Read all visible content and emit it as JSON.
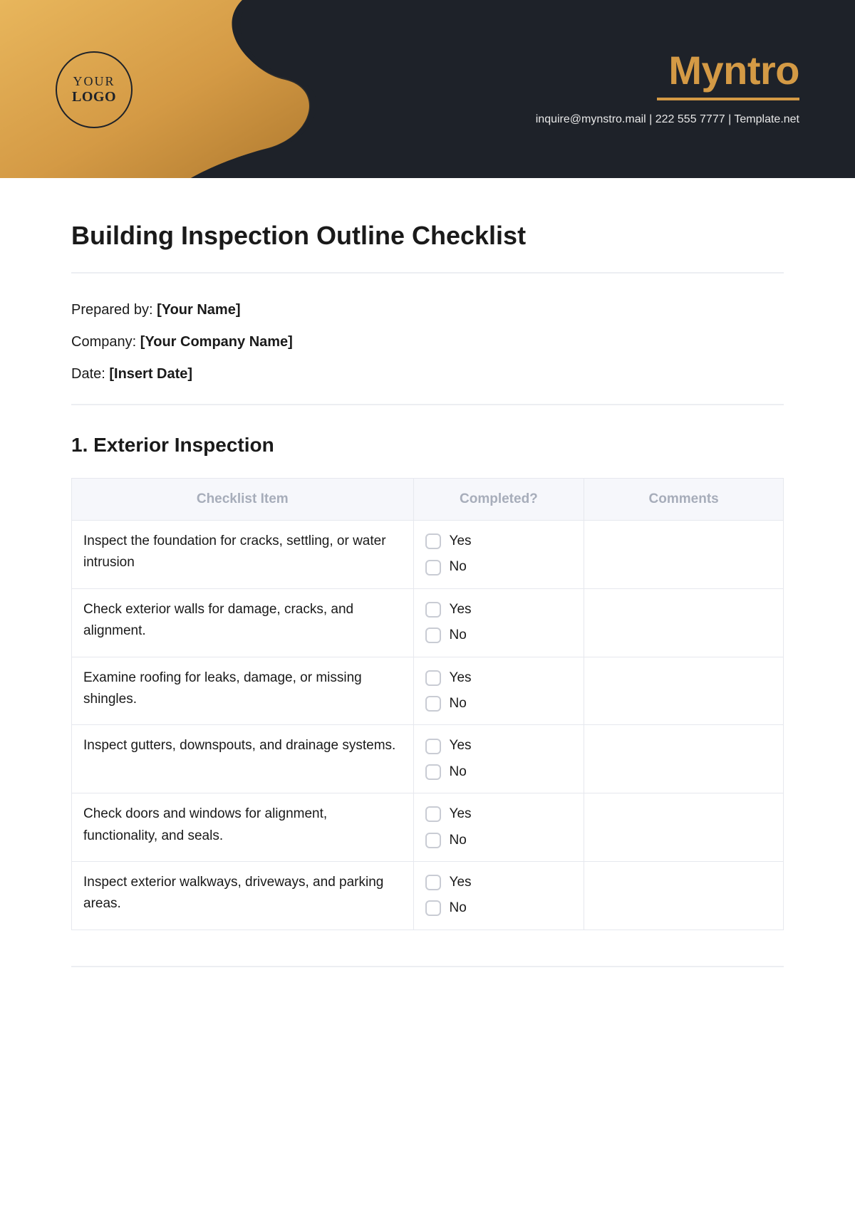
{
  "header": {
    "logo_line1": "YOUR",
    "logo_line2": "LOGO",
    "brand_name": "Myntro",
    "contact_email": "inquire@mynstro.mail",
    "contact_phone": "222 555 7777",
    "contact_site": "Template.net",
    "separator": "  |  "
  },
  "document": {
    "title": "Building Inspection Outline Checklist",
    "meta": {
      "prepared_by_label": "Prepared by: ",
      "prepared_by_value": "[Your Name]",
      "company_label": "Company: ",
      "company_value": "[Your Company Name]",
      "date_label": "Date: ",
      "date_value": "[Insert Date]"
    }
  },
  "section": {
    "heading": "1. Exterior Inspection",
    "headers": {
      "item": "Checklist Item",
      "completed": "Completed?",
      "comments": "Comments"
    },
    "options": {
      "yes": "Yes",
      "no": "No"
    },
    "rows": [
      {
        "item": "Inspect the foundation for cracks, settling, or water intrusion",
        "comments": ""
      },
      {
        "item": "Check exterior walls for damage, cracks, and alignment.",
        "comments": ""
      },
      {
        "item": "Examine roofing for leaks, damage, or missing shingles.",
        "comments": ""
      },
      {
        "item": "Inspect gutters, downspouts, and drainage systems.",
        "comments": ""
      },
      {
        "item": "Check doors and windows for alignment, functionality, and seals.",
        "comments": ""
      },
      {
        "item": "Inspect exterior walkways, driveways, and parking areas.",
        "comments": ""
      }
    ]
  }
}
